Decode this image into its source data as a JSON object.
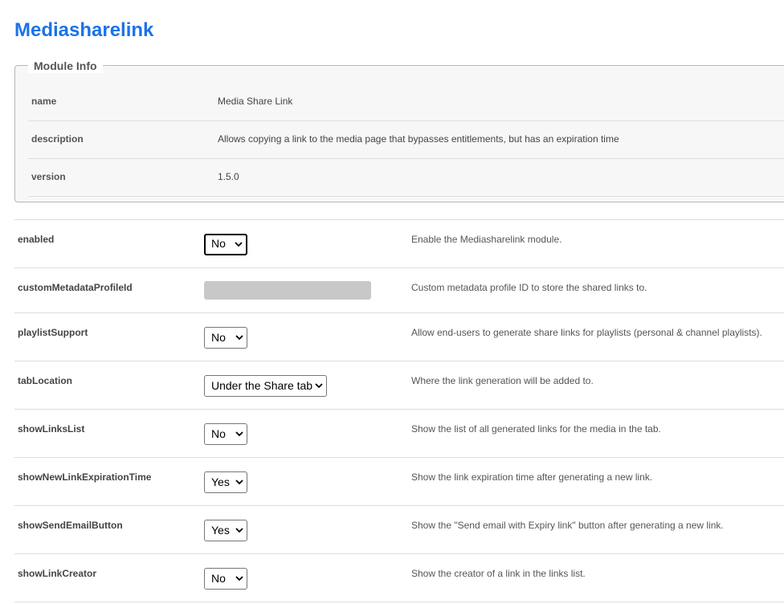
{
  "page": {
    "title": "Mediasharelink"
  },
  "module_info": {
    "legend": "Module Info",
    "rows": [
      {
        "key": "name",
        "value": "Media Share Link"
      },
      {
        "key": "description",
        "value": "Allows copying a link to the media page that bypasses entitlements, but has an expiration time"
      },
      {
        "key": "version",
        "value": "1.5.0"
      }
    ]
  },
  "settings": [
    {
      "name": "enabled",
      "value": "No",
      "description": "Enable the Mediasharelink module."
    },
    {
      "name": "customMetadataProfileId",
      "value": "",
      "description": "Custom metadata profile ID to store the shared links to."
    },
    {
      "name": "playlistSupport",
      "value": "No",
      "description": "Allow end-users to generate share links for playlists (personal & channel playlists)."
    },
    {
      "name": "tabLocation",
      "value": "Under the Share tab",
      "description": "Where the link generation will be added to."
    },
    {
      "name": "showLinksList",
      "value": "No",
      "description": "Show the list of all generated links for the media in the tab."
    },
    {
      "name": "showNewLinkExpirationTime",
      "value": "Yes",
      "description": "Show the link expiration time after generating a new link."
    },
    {
      "name": "showSendEmailButton",
      "value": "Yes",
      "description": "Show the \"Send email with Expiry link\" button after generating a new link."
    },
    {
      "name": "showLinkCreator",
      "value": "No",
      "description": "Show the creator of a link in the links list."
    }
  ],
  "colors": {
    "title": "#1a73e8",
    "panel_bg": "#f7f7f7",
    "border": "#dddddd"
  },
  "icons": {
    "select_arrow": "chevron-down-icon"
  }
}
